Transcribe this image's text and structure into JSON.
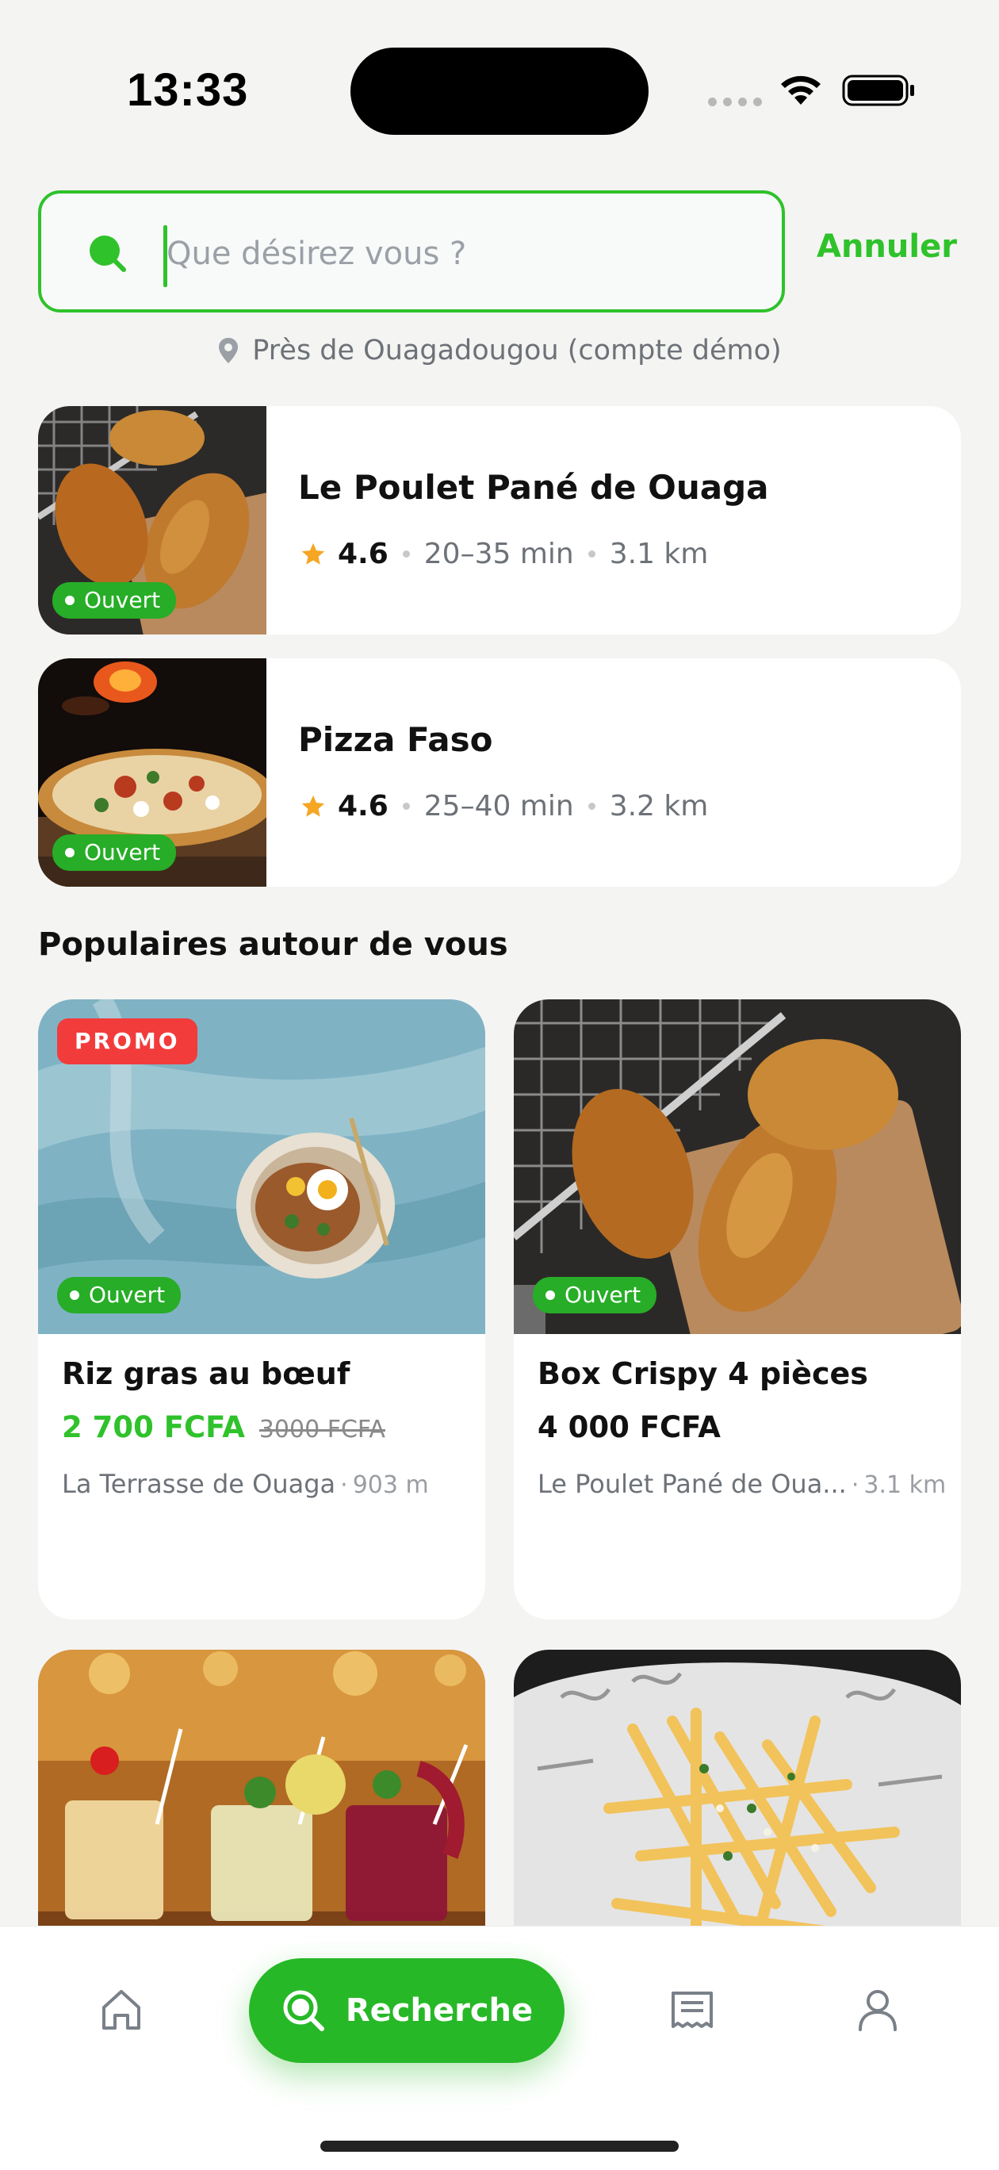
{
  "status_bar": {
    "time": "13:33"
  },
  "search": {
    "placeholder": "Que désirez vous ?",
    "cancel_label": "Annuler"
  },
  "location": {
    "text": "Près de Ouagadougou (compte démo)"
  },
  "restaurants": [
    {
      "name": "Le Poulet Pané de Ouaga",
      "rating": "4.6",
      "time": "20–35 min",
      "distance": "3.1 km",
      "status": "Ouvert",
      "image": "fried-chicken"
    },
    {
      "name": "Pizza Faso",
      "rating": "4.6",
      "time": "25–40 min",
      "distance": "3.2 km",
      "status": "Ouvert",
      "image": "pizza"
    }
  ],
  "section": {
    "title": "Populaires autour de vous"
  },
  "products": [
    {
      "badge": "PROMO",
      "status": "Ouvert",
      "name": "Riz gras au bœuf",
      "price": "2 700 FCFA",
      "old_price": "3000 FCFA",
      "store": "La Terrasse de Ouaga",
      "distance": "903 m",
      "image": "rice-plate"
    },
    {
      "status": "Ouvert",
      "name": "Box Crispy 4 pièces",
      "price": "4 000 FCFA",
      "store": "Le Poulet Pané de Oua...",
      "distance": "3.1 km",
      "image": "fried-chicken"
    },
    {
      "image": "cocktails"
    },
    {
      "image": "fries"
    }
  ],
  "nav": {
    "search_label": "Recherche",
    "items": [
      "home-icon",
      "search-icon",
      "orders-icon",
      "profile-icon"
    ]
  },
  "colors": {
    "accent": "#2fc22b",
    "open_badge": "#27ad27",
    "promo": "#f23c3c",
    "star": "#f5a623"
  }
}
